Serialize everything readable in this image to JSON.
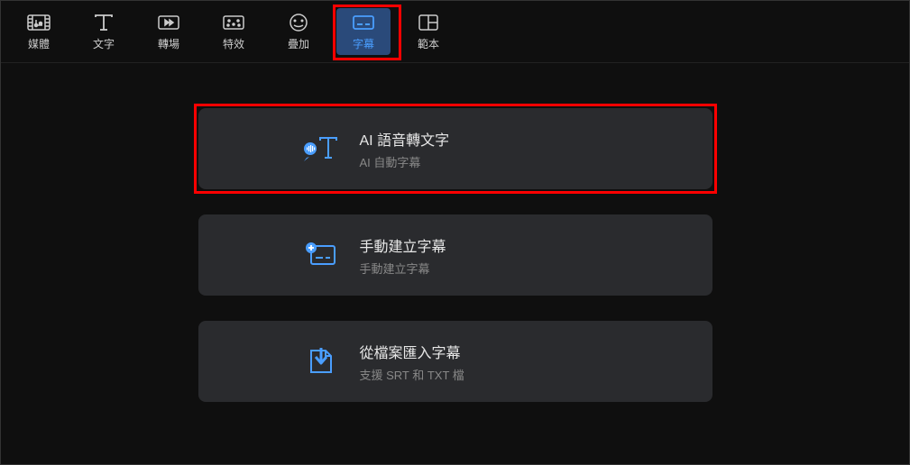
{
  "tabs": [
    {
      "label": "媒體",
      "name": "media"
    },
    {
      "label": "文字",
      "name": "text"
    },
    {
      "label": "轉場",
      "name": "transition"
    },
    {
      "label": "特效",
      "name": "effect"
    },
    {
      "label": "疊加",
      "name": "overlay"
    },
    {
      "label": "字幕",
      "name": "subtitle",
      "active": true
    },
    {
      "label": "範本",
      "name": "template"
    }
  ],
  "options": [
    {
      "title": "AI 語音轉文字",
      "subtitle": "AI 自動字幕",
      "icon": "speech-to-text",
      "highlighted": true
    },
    {
      "title": "手動建立字幕",
      "subtitle": "手動建立字幕",
      "icon": "manual-subtitle",
      "highlighted": false
    },
    {
      "title": "從檔案匯入字幕",
      "subtitle": "支援 SRT 和 TXT 檔",
      "icon": "import-file",
      "highlighted": false
    }
  ]
}
